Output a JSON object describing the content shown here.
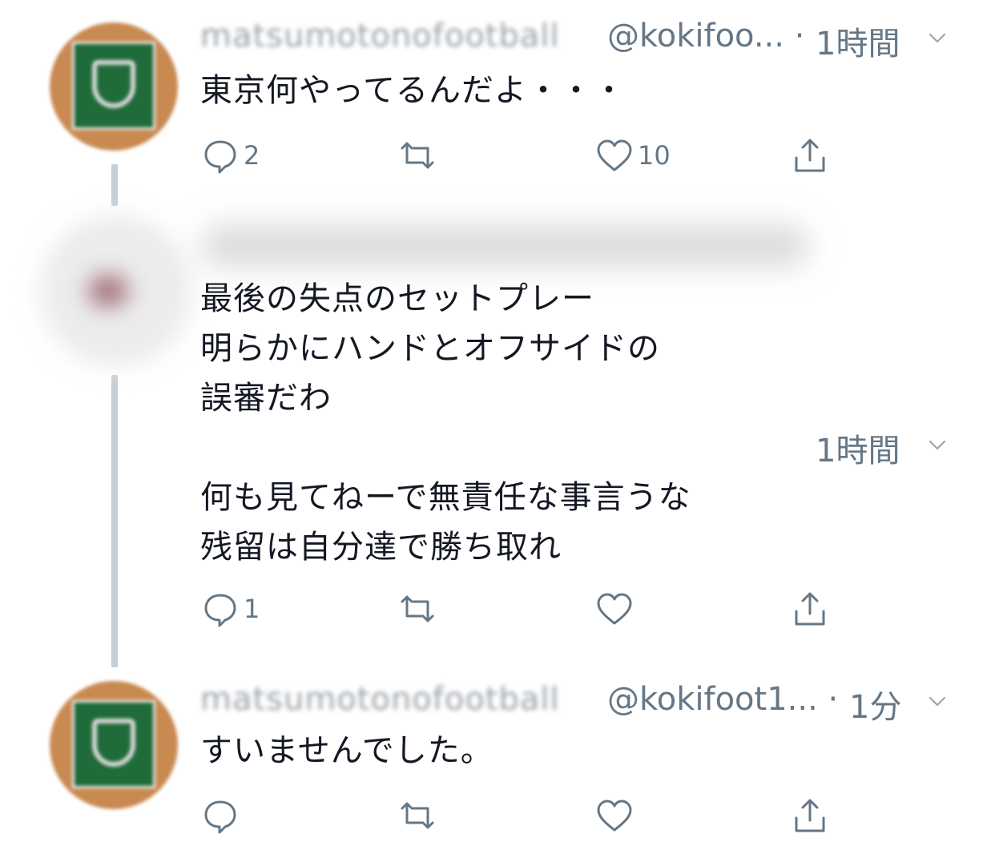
{
  "tweets": [
    {
      "name": "matsumotonofootball",
      "handle": "@kokifoo... ·",
      "time": "1時間",
      "text": "東京何やってるんだよ・・・",
      "reply_count": "2",
      "retweet_count": "",
      "like_count": "10"
    },
    {
      "name": "",
      "handle": "",
      "time": "1時間",
      "text": "最後の失点のセットプレー\n明らかにハンドとオフサイドの\n誤審だわ\n\n何も見てねーで無責任な事言うな\n残留は自分達で勝ち取れ",
      "reply_count": "1",
      "retweet_count": "",
      "like_count": ""
    },
    {
      "name": "matsumotonofootball",
      "handle": "@kokifoot1... ·",
      "time": "1分",
      "text": "すいませんでした。",
      "reply_count": "",
      "retweet_count": "",
      "like_count": ""
    }
  ],
  "icons": {
    "reply": "reply-icon",
    "retweet": "retweet-icon",
    "like": "heart-icon",
    "share": "share-icon",
    "menu": "chevron-down-icon"
  },
  "colors": {
    "secondary_text": "#657786",
    "thread_line": "#c4cfd6",
    "avatar_green": "#1f6b3a"
  }
}
